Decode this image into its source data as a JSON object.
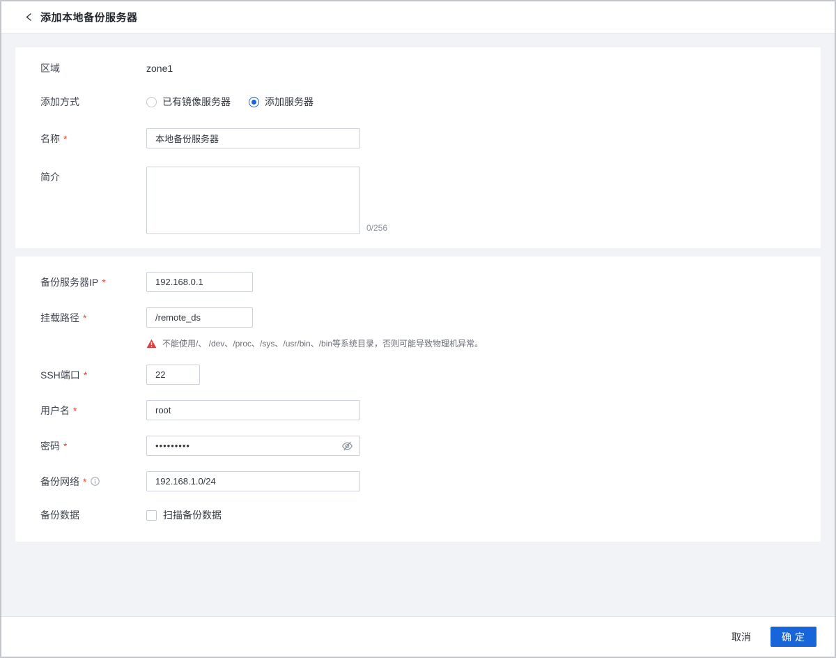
{
  "header": {
    "title": "添加本地备份服务器"
  },
  "form": {
    "zone": {
      "label": "区域",
      "value": "zone1"
    },
    "add_mode": {
      "label": "添加方式",
      "options": [
        {
          "label": "已有镜像服务器",
          "selected": false
        },
        {
          "label": "添加服务器",
          "selected": true
        }
      ]
    },
    "name": {
      "label": "名称",
      "required": "*",
      "value": "本地备份服务器"
    },
    "description": {
      "label": "简介",
      "value": "",
      "counter": "0/256"
    },
    "server_ip": {
      "label": "备份服务器IP",
      "required": "*",
      "value": "192.168.0.1"
    },
    "mount_path": {
      "label": "挂载路径",
      "required": "*",
      "value": "/remote_ds",
      "warning": "不能使用/、 /dev、/proc、/sys、/usr/bin、/bin等系统目录，否则可能导致物理机异常。"
    },
    "ssh_port": {
      "label": "SSH端口",
      "required": "*",
      "value": "22"
    },
    "username": {
      "label": "用户名",
      "required": "*",
      "value": "root"
    },
    "password": {
      "label": "密码",
      "required": "*",
      "value": "•••••••••"
    },
    "backup_network": {
      "label": "备份网络",
      "required": "*",
      "value": "192.168.1.0/24"
    },
    "backup_data": {
      "label": "备份数据",
      "checkbox_label": "扫描备份数据",
      "checked": false
    }
  },
  "footer": {
    "cancel_label": "取消",
    "confirm_label": "确定"
  },
  "colors": {
    "accent_blue": "#1765d8",
    "required_red": "#f04134",
    "warning_red": "#e23c3c"
  }
}
